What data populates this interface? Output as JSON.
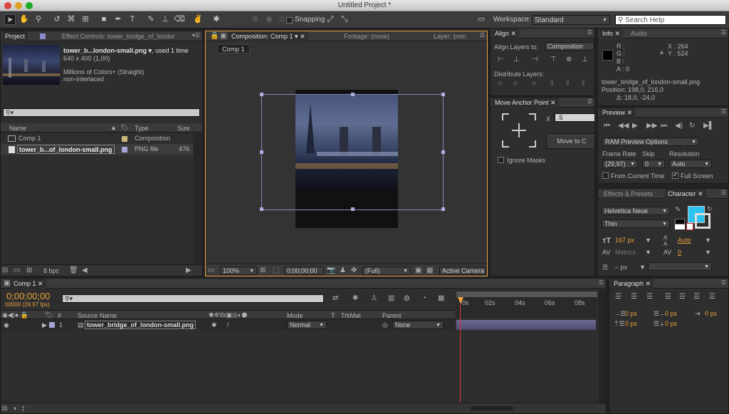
{
  "window": {
    "title": "Untitled Project *"
  },
  "toolbar": {
    "snapping_label": "Snapping",
    "workspace_label": "Workspace:",
    "workspace_value": "Standard",
    "search_placeholder": "Search Help"
  },
  "project": {
    "tab_project": "Project",
    "tab_effect_controls": "Effect Controls: tower_bridge_of_londor",
    "file_name": "tower_b...london-small.png ▾",
    "used": ", used 1 time",
    "dims": "640 x 400 (1,00)",
    "colors": "Millions of Colors+ (Straight)",
    "interlace": "non-interlaced",
    "columns": {
      "name": "Name",
      "type": "Type",
      "size": "Size"
    },
    "items": [
      {
        "name": "Comp 1",
        "type": "Composition",
        "size": "",
        "color": "#c8b97a"
      },
      {
        "name": "tower_b...of_london-small.png",
        "type": "PNG file",
        "size": "476",
        "color": "#a7a5d8"
      }
    ],
    "bpc": "8 bpc"
  },
  "composition": {
    "tab_comp": "Composition: Comp 1",
    "tab_footage": "Footage: (none)",
    "tab_layer": "Layer: (non",
    "comp_button": "Comp 1",
    "zoom": "100%",
    "timecode": "0;00;00;00",
    "resolution": "(Full)",
    "camera": "Active Camera"
  },
  "align": {
    "tab": "Align",
    "align_to_label": "Align Layers to:",
    "align_to_value": "Composition",
    "distribute_label": "Distribute Layers:"
  },
  "anchor": {
    "tab": "Move Anchor Point",
    "x_label": "X",
    "x_value": ".5",
    "move_button": "Move to C",
    "ignore_masks": "Ignore Masks"
  },
  "info": {
    "tab_info": "Info",
    "tab_audio": "Audio",
    "r": "R :",
    "g": "G :",
    "b": "B :",
    "a": "A : 0",
    "x": "X : 264",
    "y": "Y : 524",
    "file": "tower_bridge_of_london-small.png",
    "position": "Position: 198,0, 216,0",
    "delta": "Δ: 18,0, -24,0"
  },
  "preview": {
    "tab": "Preview",
    "ram_options": "RAM Preview Options",
    "frame_rate_label": "Frame Rate",
    "skip_label": "Skip",
    "resolution_label": "Resolution",
    "frame_rate": "(29,97)",
    "skip": "0",
    "resolution": "Auto",
    "from_current": "From Current Time",
    "full_screen": "Full Screen"
  },
  "character": {
    "tab_effects": "Effects & Presets",
    "tab_character": "Character",
    "font": "Helvetica Neue",
    "style": "Thin",
    "size": "167 px",
    "leading": "Auto",
    "kerning": "Metrics",
    "tracking": "0",
    "stroke": "– px",
    "fill_color": "#2bc4f2"
  },
  "timeline": {
    "tab": "Comp 1",
    "timecode": "0;00;00;00",
    "fps": "00000 (29.97 fps)",
    "source_name_col": "Source Name",
    "mode_col": "Mode",
    "t_col": "T",
    "trkmat_col": "TrkMat",
    "parent_col": "Parent",
    "layer_num": "1",
    "layer_name": "tower_bridge_of_london-small.png",
    "layer_mode": "Normal",
    "layer_parent": "None",
    "ticks": [
      "0s",
      "02s",
      "04s",
      "06s",
      "08s"
    ]
  },
  "paragraph": {
    "tab": "Paragraph",
    "v1": "0 px",
    "v2": "0 px",
    "v3": "0 px",
    "v4": "0 px",
    "v5": "0 px"
  }
}
